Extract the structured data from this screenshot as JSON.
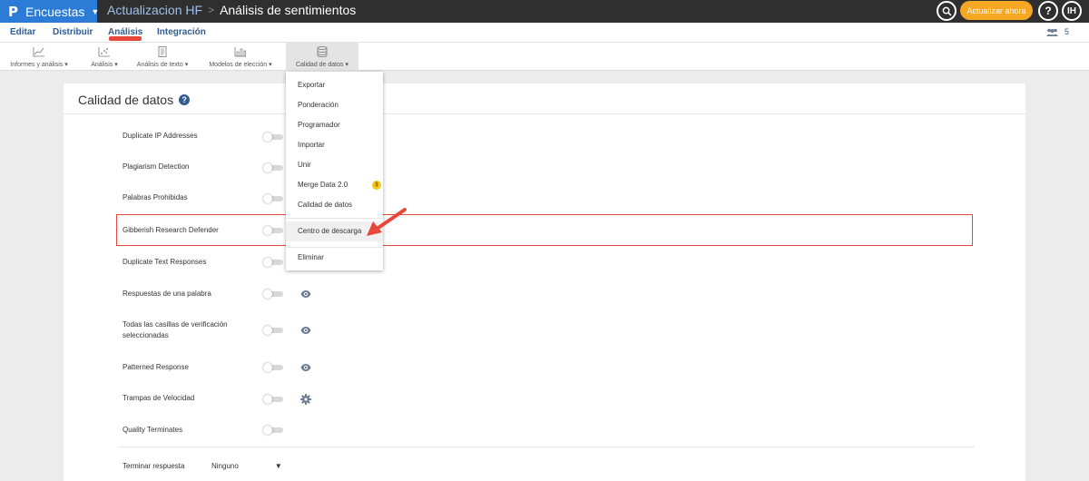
{
  "topbar": {
    "logo": "P",
    "brand": "Encuestas",
    "crumb_survey": "Actualizacion HF",
    "crumb_separator": ">",
    "crumb_page": "Análisis de sentimientos",
    "upgrade_button": "Actualizar ahora",
    "help_label": "?",
    "avatar_initials": "IH"
  },
  "nav": {
    "tabs": [
      "Editar",
      "Distribuir",
      "Análisis",
      "Integración"
    ],
    "active_tab": "Análisis",
    "users_count": "5"
  },
  "toolbar": {
    "tools": [
      "Informes y análisis",
      "Análisis",
      "Análisis de texto",
      "Modelos de elección",
      "Calidad de datos"
    ],
    "active_tool": "Calidad de datos"
  },
  "card": {
    "title": "Calidad de datos",
    "rows": [
      {
        "label": "Duplicate IP Addresses",
        "icon": ""
      },
      {
        "label": "Plagiarism Detection",
        "icon": ""
      },
      {
        "label": "Palabras Prohibidas",
        "icon": ""
      },
      {
        "label": "Gibberish Research Defender",
        "icon": ""
      },
      {
        "label": "Duplicate Text Responses",
        "icon": ""
      },
      {
        "label": "Respuestas de una palabra",
        "icon": "eye-icon"
      },
      {
        "label": "Todas las casillas de verificación seleccionadas",
        "icon": "eye-icon"
      },
      {
        "label": "Patterned Response",
        "icon": "eye-icon"
      },
      {
        "label": "Trampas de Velocidad",
        "icon": "gear-icon"
      },
      {
        "label": "Quality Terminates",
        "icon": ""
      }
    ],
    "end_label": "Terminar respuesta",
    "end_value": "Ninguno"
  },
  "dropdown": {
    "items": [
      "Exportar",
      "Ponderación",
      "Programador",
      "Importar",
      "Unir",
      "Merge Data 2.0",
      "Calidad de datos",
      "Centro de descarga",
      "Eliminar"
    ],
    "highlighted": "Centro de descarga"
  },
  "colors": {
    "brand_blue": "#2b7bd7",
    "topbar_bg": "#2f2f2f",
    "accent_orange": "#f5a623",
    "annotation_red": "#e8473c",
    "link_blue": "#2f5d8f"
  }
}
